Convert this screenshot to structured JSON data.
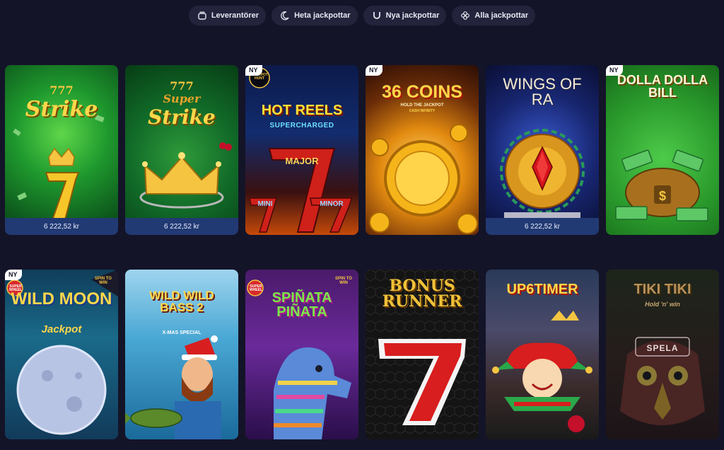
{
  "filters": [
    {
      "label": "Leverantörer",
      "icon": "provider-icon"
    },
    {
      "label": "Heta jackpottar",
      "icon": "moon-icon"
    },
    {
      "label": "Nya jackpottar",
      "icon": "horseshoe-icon"
    },
    {
      "label": "Alla jackpottar",
      "icon": "clover-icon"
    }
  ],
  "games": [
    {
      "title": "Strike",
      "title_prefix": "777",
      "price": "6 222,52 kr",
      "new_label": ""
    },
    {
      "title_top": "Super",
      "title": "Strike",
      "title_prefix": "777",
      "price": "6 222,52 kr",
      "new_label": ""
    },
    {
      "title": "HOT REELS",
      "subtitle": "SUPERCHARGED",
      "labels": [
        "MAJOR",
        "MINI",
        "MINOR"
      ],
      "badge": "JACKPOT HUNT",
      "new_label": "NY"
    },
    {
      "title": "36 COINS",
      "subtitle": "HOLD THE JACKPOT",
      "subtitle2": "CASH INFINITY",
      "new_label": "NY"
    },
    {
      "title": "WINGS OF RA",
      "price": "6 222,52 kr",
      "new_label": ""
    },
    {
      "title": "DOLLA DOLLA BILL",
      "new_label": "NY"
    },
    {
      "title": "WILD MOON",
      "subtitle": "Jackpot",
      "badge_left": "SUPER WHEEL",
      "badge_right": "SPIN TO WIN",
      "new_label": "NY"
    },
    {
      "title": "WILD WILD BASS 2",
      "subtitle": "X-MAS SPECIAL",
      "new_label": ""
    },
    {
      "title": "SPIÑATA PIÑATA",
      "badge_left": "SUPER WHEEL",
      "badge_right": "SPIN TO WIN",
      "new_label": ""
    },
    {
      "title": "BONUS RUNNER",
      "new_label": ""
    },
    {
      "title": "UP6TIMER",
      "new_label": ""
    },
    {
      "title": "TIKI TIKI",
      "subtitle": "Hold 'n' win",
      "overlay": "SPELA",
      "new_label": ""
    }
  ],
  "colors": {
    "background": "#141428",
    "chip": "#23233c",
    "price_bar": "#223a74",
    "gold": "#f5c542"
  }
}
